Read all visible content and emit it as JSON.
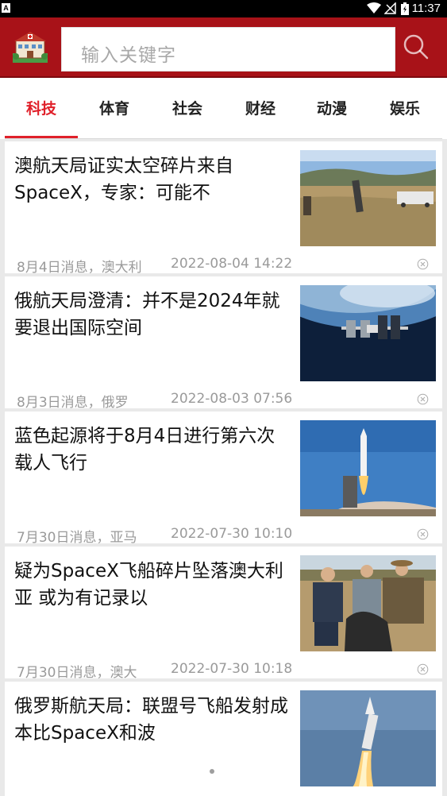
{
  "status_bar": {
    "left_glyph": "A",
    "time": "11:37"
  },
  "search": {
    "placeholder": "输入关键字"
  },
  "tabs": [
    {
      "label": "科技",
      "active": true
    },
    {
      "label": "体育",
      "active": false
    },
    {
      "label": "社会",
      "active": false
    },
    {
      "label": "财经",
      "active": false
    },
    {
      "label": "动漫",
      "active": false
    },
    {
      "label": "娱乐",
      "active": false
    }
  ],
  "news": [
    {
      "title": "澳航天局证实太空碎片来自SpaceX，专家：可能不",
      "source": "8月4日消息，澳大利",
      "datetime": "2022-08-04 14:22",
      "image": "field-with-debris"
    },
    {
      "title": "俄航天局澄清：并不是2024年就要退出国际空间",
      "source": "8月3日消息，俄罗",
      "datetime": "2022-08-03 07:56",
      "image": "iss-over-earth"
    },
    {
      "title": "蓝色起源将于8月4日进行第六次载人飞行",
      "source": "7月30日消息，亚马",
      "datetime": "2022-07-30 10:10",
      "image": "rocket-launch-pad"
    },
    {
      "title": "疑为SpaceX飞船碎片坠落澳大利亚 或为有记录以",
      "source": "7月30日消息，澳大",
      "datetime": "2022-07-30 10:18",
      "image": "farmers-with-debris"
    },
    {
      "title": "俄罗斯航天局：联盟号飞船发射成本比SpaceX和波",
      "source": "",
      "datetime": "",
      "image": "soyuz-launch"
    }
  ],
  "colors": {
    "header_bg": "#a81218",
    "tab_active": "#e0202a",
    "feed_bg": "#e9e9e9"
  },
  "icons": [
    "hospital-logo-icon",
    "search-icon",
    "close-icon",
    "wifi-icon",
    "signal-icon",
    "battery-icon"
  ]
}
